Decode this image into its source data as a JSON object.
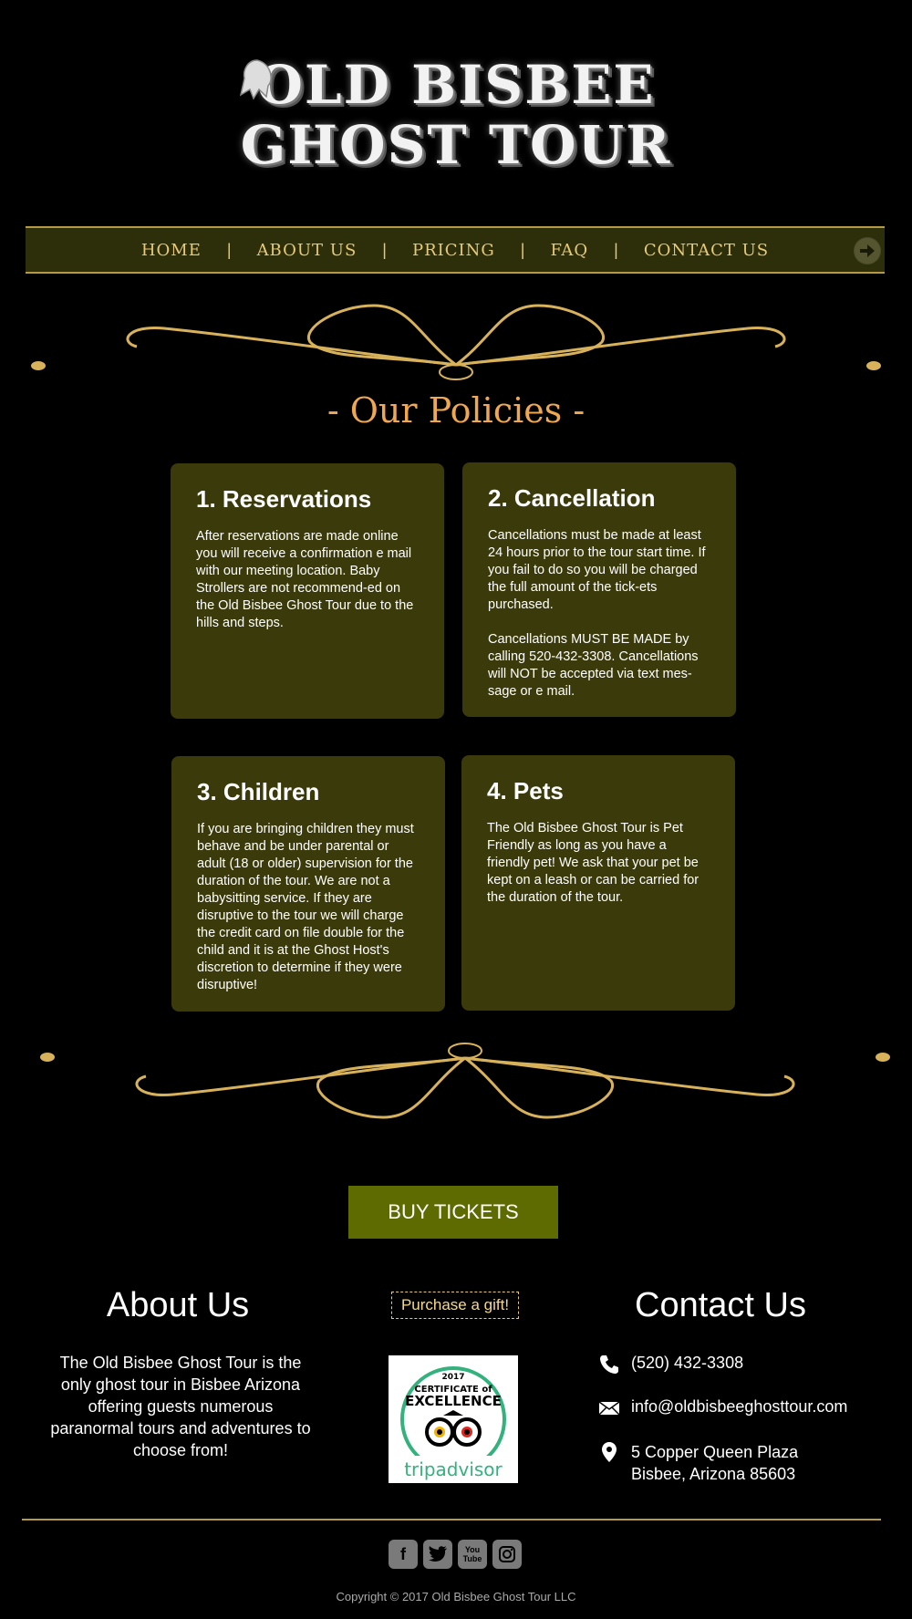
{
  "logo": {
    "line1": "OLD BISBEE",
    "line2": "GHOST TOUR"
  },
  "nav": {
    "items": [
      "HOME",
      "ABOUT US",
      "PRICING",
      "FAQ",
      "CONTACT US"
    ],
    "separator": "|"
  },
  "policies": {
    "title": "- Our Policies -",
    "cards": [
      {
        "title": "1. Reservations",
        "paragraphs": [
          "After reservations are made online you will receive a confirmation e mail with our meeting location. Baby Strollers are not recommend-ed on the Old Bisbee  Ghost Tour due to the hills and steps."
        ]
      },
      {
        "title": "2. Cancellation",
        "paragraphs": [
          "Cancellations must be made at least 24 hours prior to the tour start time. If you fail to do so you will be charged the full amount of the tick-ets purchased.",
          "Cancellations MUST BE MADE by calling 520-432-3308. Cancellations will NOT be accepted via text mes-sage or e mail."
        ]
      },
      {
        "title": "3. Children",
        "paragraphs": [
          "If you are bringing children they must behave and be under parental or adult (18 or older) supervision for the duration of the tour. We are not a babysitting service. If they are disruptive to the tour we will charge the credit card on file double for the child and it is at the Ghost Host's discretion to determine if they were disruptive!"
        ]
      },
      {
        "title": "4. Pets",
        "paragraphs": [
          "The Old Bisbee Ghost Tour is Pet Friendly as long as you have a friendly pet! We ask that your pet be kept on a leash or can be carried for the duration of the tour."
        ]
      }
    ]
  },
  "buy_tickets": "BUY TICKETS",
  "about": {
    "heading": "About Us",
    "text": "The Old Bisbee Ghost Tour is  the only ghost tour in Bisbee Arizona offering guests numerous paranormal tours and adventures to choose from!"
  },
  "gift": "Purchase a gift!",
  "tripadvisor": {
    "year": "2017",
    "line1": "CERTIFICATE of",
    "line2": "EXCELLENCE",
    "brand": "tripadvisor"
  },
  "contact": {
    "heading": "Contact Us",
    "phone": "(520) 432-3308",
    "email": "info@oldbisbeeghosttour.com",
    "address1": "5 Copper Queen Plaza",
    "address2": "Bisbee, Arizona 85603"
  },
  "socials": {
    "facebook": "f",
    "youtube_line1": "You",
    "youtube_line2": "Tube"
  },
  "copyright": "Copyright © 2017 Old Bisbee Ghost Tour LLC",
  "colors": {
    "gold": "#b59a45",
    "card": "#3b3a0b",
    "nav": "#2d2f0a",
    "title": "#f0a850",
    "button": "#5e6b00"
  }
}
